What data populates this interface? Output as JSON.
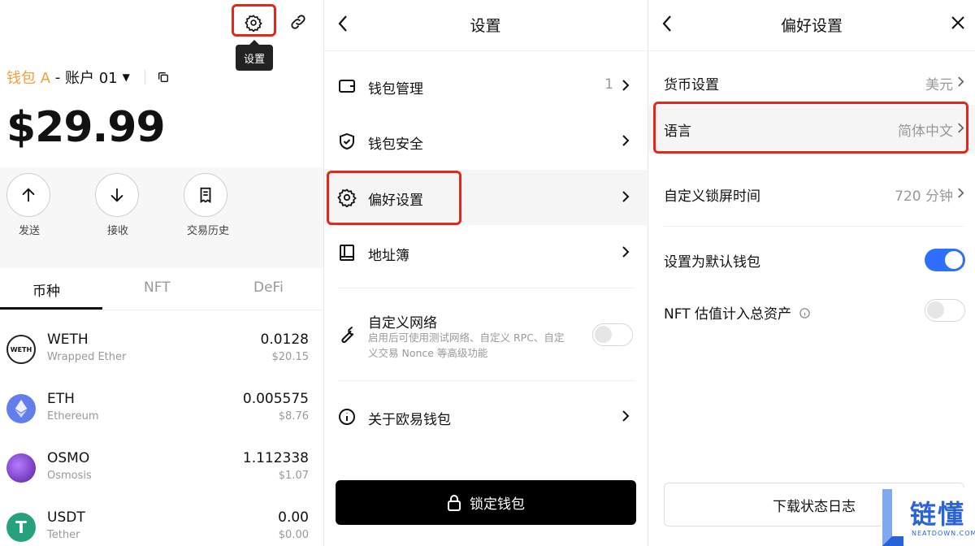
{
  "panel1": {
    "tooltip": "设置",
    "account": {
      "wallet": "钱包 A",
      "sep": " - ",
      "account": "账户 01"
    },
    "balance": "$29.99",
    "actions": [
      {
        "label": "发送",
        "icon": "arrow-up-icon"
      },
      {
        "label": "接收",
        "icon": "arrow-down-icon"
      },
      {
        "label": "交易历史",
        "icon": "history-icon"
      }
    ],
    "tabs": [
      "币种",
      "NFT",
      "DeFi"
    ],
    "tokens": [
      {
        "symbol": "WETH",
        "name": "Wrapped Ether",
        "amount": "0.0128",
        "usd": "$20.15",
        "logo_text": "WETH",
        "color": "#ffffff"
      },
      {
        "symbol": "ETH",
        "name": "Ethereum",
        "amount": "0.005575",
        "usd": "$8.76",
        "logo_text": "",
        "color": "#627eea"
      },
      {
        "symbol": "OSMO",
        "name": "Osmosis",
        "amount": "1.112338",
        "usd": "$1.07",
        "logo_text": "",
        "color": "#7b2fbe"
      },
      {
        "symbol": "USDT",
        "name": "Tether",
        "amount": "0.00",
        "usd": "$0.00",
        "logo_text": "T",
        "color": "#26a17b"
      }
    ]
  },
  "panel2": {
    "title": "设置",
    "items": [
      {
        "label": "钱包管理",
        "value": "1"
      },
      {
        "label": "钱包安全",
        "value": ""
      },
      {
        "label": "偏好设置",
        "value": ""
      },
      {
        "label": "地址簿",
        "value": ""
      }
    ],
    "custom_network": {
      "label": "自定义网络",
      "desc_line1": "启用后可使用测试网络、自定义 RPC、自定",
      "desc_line2": "义交易 Nonce 等高级功能",
      "enabled": false
    },
    "about": {
      "label": "关于欧易钱包"
    },
    "lock_button": "锁定钱包"
  },
  "panel3": {
    "title": "偏好设置",
    "rows": [
      {
        "label": "货币设置",
        "value": "美元"
      },
      {
        "label": "语言",
        "value": "简体中文"
      },
      {
        "label": "自定义锁屏时间",
        "value": "720 分钟"
      }
    ],
    "toggles": [
      {
        "label": "设置为默认钱包",
        "enabled": true
      },
      {
        "label": "NFT 估值计入总资产",
        "enabled": false
      }
    ],
    "download_button": "下载状态日志"
  },
  "watermark": {
    "title": "链懂",
    "sub": "NEATDOWN.COM"
  },
  "colors": {
    "highlight": "#e0281c",
    "accent": "#2f6fff",
    "wallet": "#f0a040"
  }
}
